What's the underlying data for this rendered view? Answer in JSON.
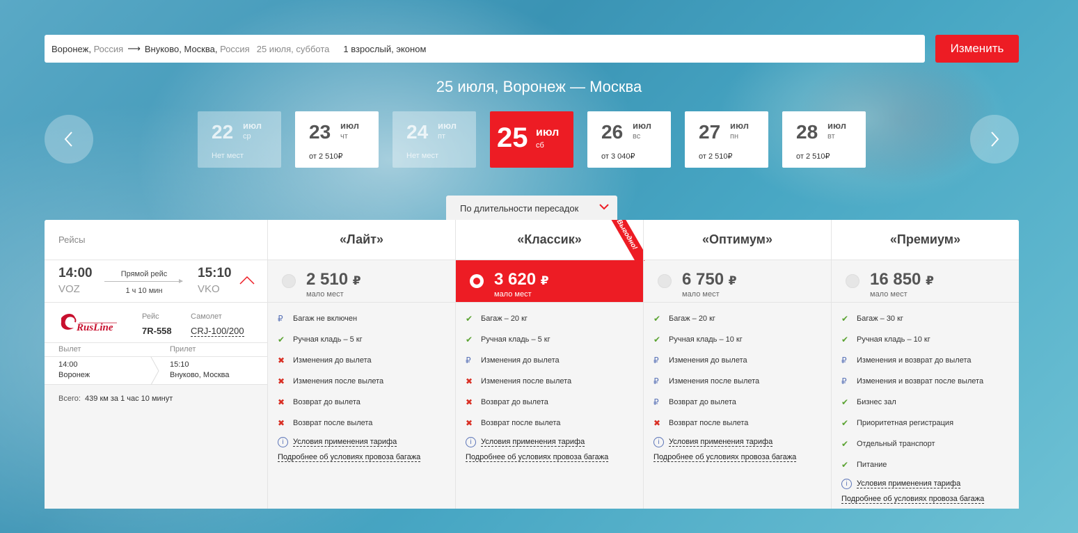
{
  "search": {
    "from_city": "Воронеж,",
    "from_country": "Россия",
    "to_city": "Внуково, Москва,",
    "to_country": "Россия",
    "date": "25 июля, суббота",
    "passengers": "1 взрослый, эконом",
    "change_label": "Изменить"
  },
  "route_title": "25 июля, Воронеж — Москва",
  "dates": [
    {
      "day": "22",
      "month": "июл",
      "wday": "ср",
      "price": "Нет мест",
      "state": "disabled"
    },
    {
      "day": "23",
      "month": "июл",
      "wday": "чт",
      "price": "от 2 510₽",
      "state": "normal"
    },
    {
      "day": "24",
      "month": "июл",
      "wday": "пт",
      "price": "Нет мест",
      "state": "disabled"
    },
    {
      "day": "25",
      "month": "июл",
      "wday": "сб",
      "price": "",
      "state": "active"
    },
    {
      "day": "26",
      "month": "июл",
      "wday": "вс",
      "price": "от 3 040₽",
      "state": "normal"
    },
    {
      "day": "27",
      "month": "июл",
      "wday": "пн",
      "price": "от 2 510₽",
      "state": "normal"
    },
    {
      "day": "28",
      "month": "июл",
      "wday": "вт",
      "price": "от 2 510₽",
      "state": "normal"
    }
  ],
  "sort": {
    "label": "По длительности пересадок"
  },
  "flights_header": "Рейсы",
  "flight": {
    "dep_time": "14:00",
    "dep_code": "VOZ",
    "arr_time": "15:10",
    "arr_code": "VKO",
    "direct": "Прямой рейс",
    "duration": "1 ч 10 мин",
    "airline": "RusLine",
    "flight_label": "Рейс",
    "flight_no": "7R-558",
    "aircraft_label": "Самолет",
    "aircraft": "CRJ-100/200",
    "departure_label": "Вылет",
    "arrival_label": "Прилет",
    "dep_detail_time": "14:00",
    "dep_detail_city": "Воронеж",
    "arr_detail_time": "15:10",
    "arr_detail_city": "Внуково, Москва",
    "total_label": "Всего:",
    "total": "439 км за 1 час 10 минут"
  },
  "ribbon": "Выгодно!",
  "common": {
    "few_seats": "мало мест",
    "currency": "₽",
    "conditions": "Условия применения тарифа",
    "baggage": "Подробнее об условиях провоза багажа"
  },
  "tariffs": [
    {
      "name": "«Лайт»",
      "price": "2 510",
      "selected": false,
      "features": [
        {
          "icon": "fee",
          "text": "Багаж не включен"
        },
        {
          "icon": "check",
          "text": "Ручная кладь – 5 кг"
        },
        {
          "icon": "cross",
          "text": "Изменения до вылета"
        },
        {
          "icon": "cross",
          "text": "Изменения после вылета"
        },
        {
          "icon": "cross",
          "text": "Возврат до вылета"
        },
        {
          "icon": "cross",
          "text": "Возврат после вылета"
        }
      ]
    },
    {
      "name": "«Классик»",
      "price": "3 620",
      "selected": true,
      "features": [
        {
          "icon": "check",
          "text": "Багаж – 20 кг"
        },
        {
          "icon": "check",
          "text": "Ручная кладь – 5 кг"
        },
        {
          "icon": "fee",
          "text": "Изменения до вылета"
        },
        {
          "icon": "cross",
          "text": "Изменения после вылета"
        },
        {
          "icon": "cross",
          "text": "Возврат до вылета"
        },
        {
          "icon": "cross",
          "text": "Возврат после вылета"
        }
      ]
    },
    {
      "name": "«Оптимум»",
      "price": "6 750",
      "selected": false,
      "features": [
        {
          "icon": "check",
          "text": "Багаж – 20 кг"
        },
        {
          "icon": "check",
          "text": "Ручная кладь – 10 кг"
        },
        {
          "icon": "fee",
          "text": "Изменения до вылета"
        },
        {
          "icon": "fee",
          "text": "Изменения после вылета"
        },
        {
          "icon": "fee",
          "text": "Возврат до вылета"
        },
        {
          "icon": "cross",
          "text": "Возврат после вылета"
        }
      ]
    },
    {
      "name": "«Премиум»",
      "price": "16 850",
      "selected": false,
      "features": [
        {
          "icon": "check",
          "text": "Багаж – 30 кг"
        },
        {
          "icon": "check",
          "text": "Ручная кладь – 10 кг"
        },
        {
          "icon": "fee",
          "text": "Изменения и возврат до вылета"
        },
        {
          "icon": "fee",
          "text": "Изменения и возврат после вылета"
        },
        {
          "icon": "check",
          "text": "Бизнес зал"
        },
        {
          "icon": "check",
          "text": "Приоритетная регистрация"
        },
        {
          "icon": "check",
          "text": "Отдельный транспорт"
        },
        {
          "icon": "check",
          "text": "Питание"
        }
      ]
    }
  ],
  "colors": {
    "accent": "#ed1c24",
    "check": "#5ba332",
    "cross": "#d93025",
    "fee": "#5b74b8"
  }
}
